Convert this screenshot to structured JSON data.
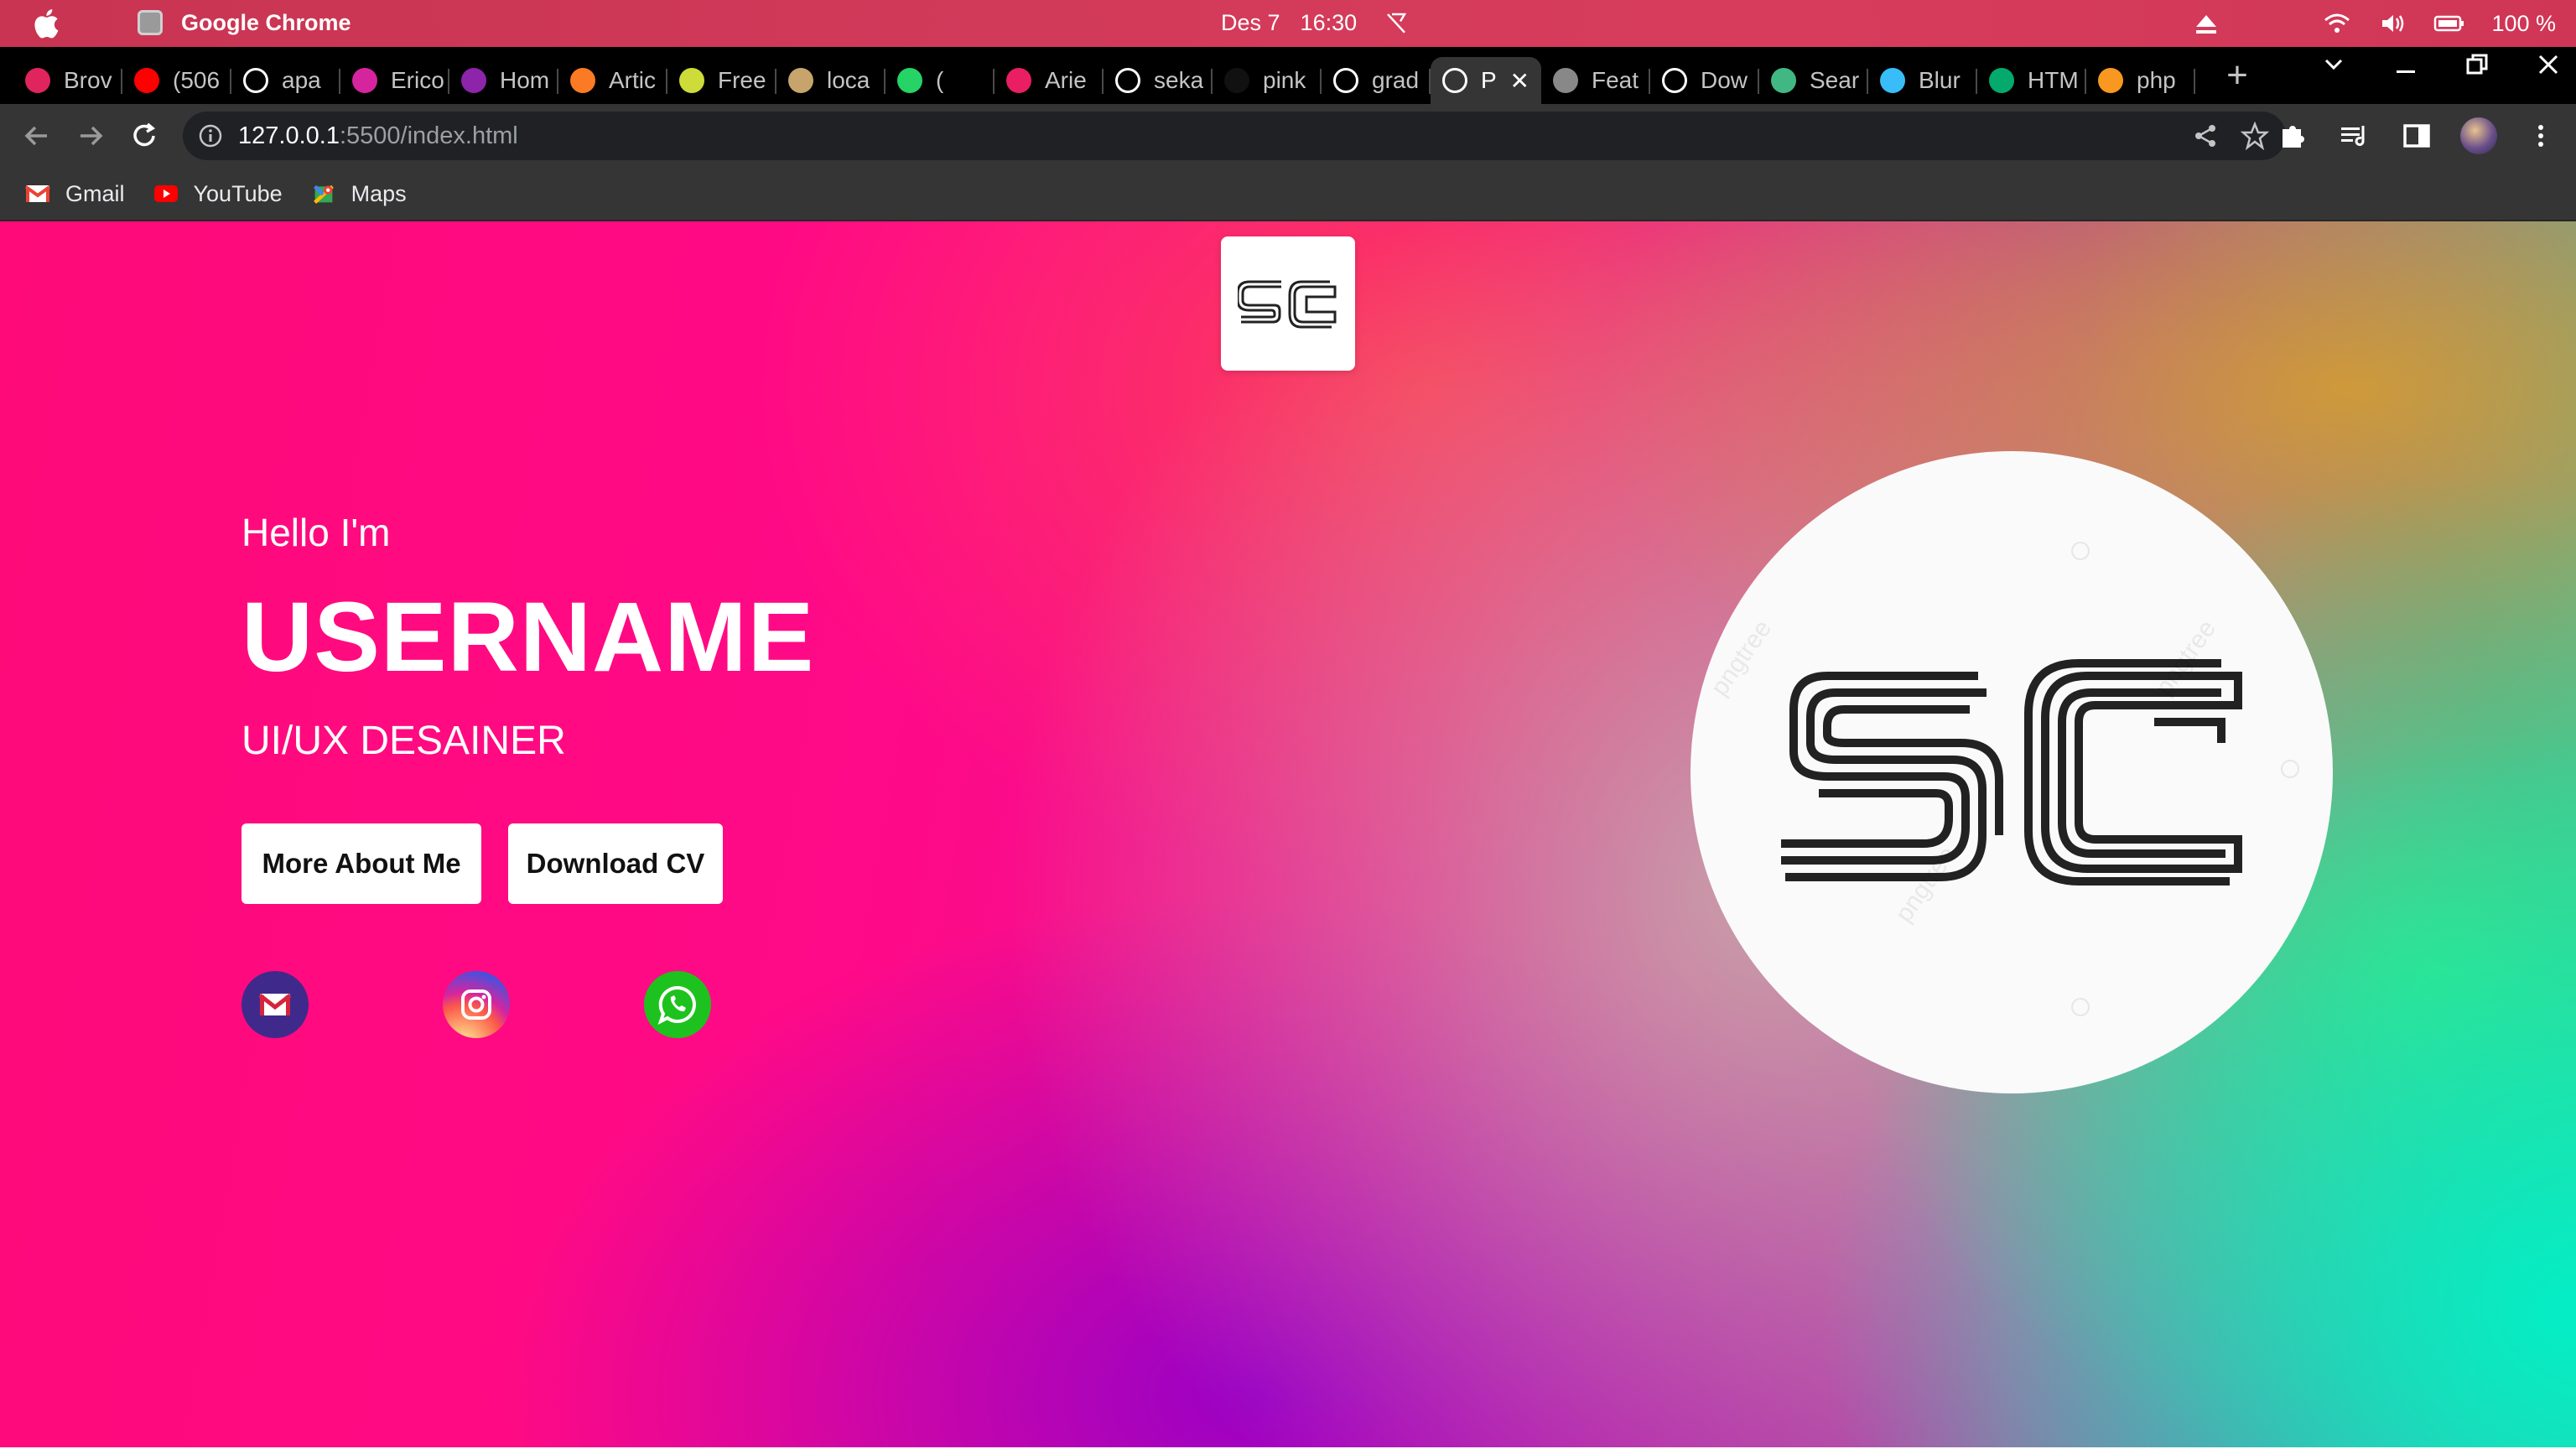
{
  "menubar": {
    "app_name": "Google Chrome",
    "date": "Des 7",
    "time": "16:30",
    "battery": "100 %"
  },
  "tabs": [
    {
      "label": "Brov",
      "favicon": "circle-icon",
      "color": "#e0245e"
    },
    {
      "label": "(506",
      "favicon": "youtube-icon",
      "color": "#ff0000"
    },
    {
      "label": "apa",
      "favicon": "google-icon",
      "color": "#ffffff"
    },
    {
      "label": "Erico",
      "favicon": "instagram-icon",
      "color": "#d6249f"
    },
    {
      "label": "Hom",
      "favicon": "site-icon",
      "color": "#8e24aa"
    },
    {
      "label": "Artic",
      "favicon": "xampp-icon",
      "color": "#fb7a24"
    },
    {
      "label": "Free",
      "favicon": "image-icon",
      "color": "#cddc39"
    },
    {
      "label": "loca",
      "favicon": "tent-icon",
      "color": "#c7a46b"
    },
    {
      "label": "(",
      "favicon": "whatsapp-icon",
      "color": "#25d366"
    },
    {
      "label": "Arie",
      "favicon": "a-icon",
      "color": "#e91e63"
    },
    {
      "label": "seka",
      "favicon": "google-icon",
      "color": "#ffffff"
    },
    {
      "label": "pink",
      "favicon": "dark-icon",
      "color": "#111111"
    },
    {
      "label": "grad",
      "favicon": "globe-icon",
      "color": "#ffffff"
    },
    {
      "label": "P",
      "favicon": "globe-icon",
      "color": "#ffffff"
    },
    {
      "label": "Feat",
      "favicon": "leaf-icon",
      "color": "#888888"
    },
    {
      "label": "Dow",
      "favicon": "globe-icon",
      "color": "#ffffff"
    },
    {
      "label": "Sear",
      "favicon": "vue-icon",
      "color": "#41b883"
    },
    {
      "label": "Blur",
      "favicon": "tailwind-icon",
      "color": "#38bdf8"
    },
    {
      "label": "HTM",
      "favicon": "w3-icon",
      "color": "#04aa6d"
    },
    {
      "label": "php",
      "favicon": "java-icon",
      "color": "#f89820"
    }
  ],
  "active_tab_index": 13,
  "address": {
    "host": "127.0.0.1",
    "path": ":5500/index.html"
  },
  "bookmarks": [
    {
      "label": "Gmail",
      "icon": "gmail-icon"
    },
    {
      "label": "YouTube",
      "icon": "youtube-icon"
    },
    {
      "label": "Maps",
      "icon": "maps-icon"
    }
  ],
  "hero": {
    "logo_text": "SC",
    "greeting": "Hello I'm",
    "name": "USERNAME",
    "role": "UI/UX DESAINER",
    "buttons": {
      "about": "More About Me",
      "cv": "Download CV"
    },
    "socials": [
      "mail-icon",
      "instagram-icon",
      "whatsapp-icon"
    ]
  },
  "colors": {
    "hero_pink": "#ff0a78",
    "hero_teal": "#00f0c8",
    "button_bg": "#ffffff"
  }
}
